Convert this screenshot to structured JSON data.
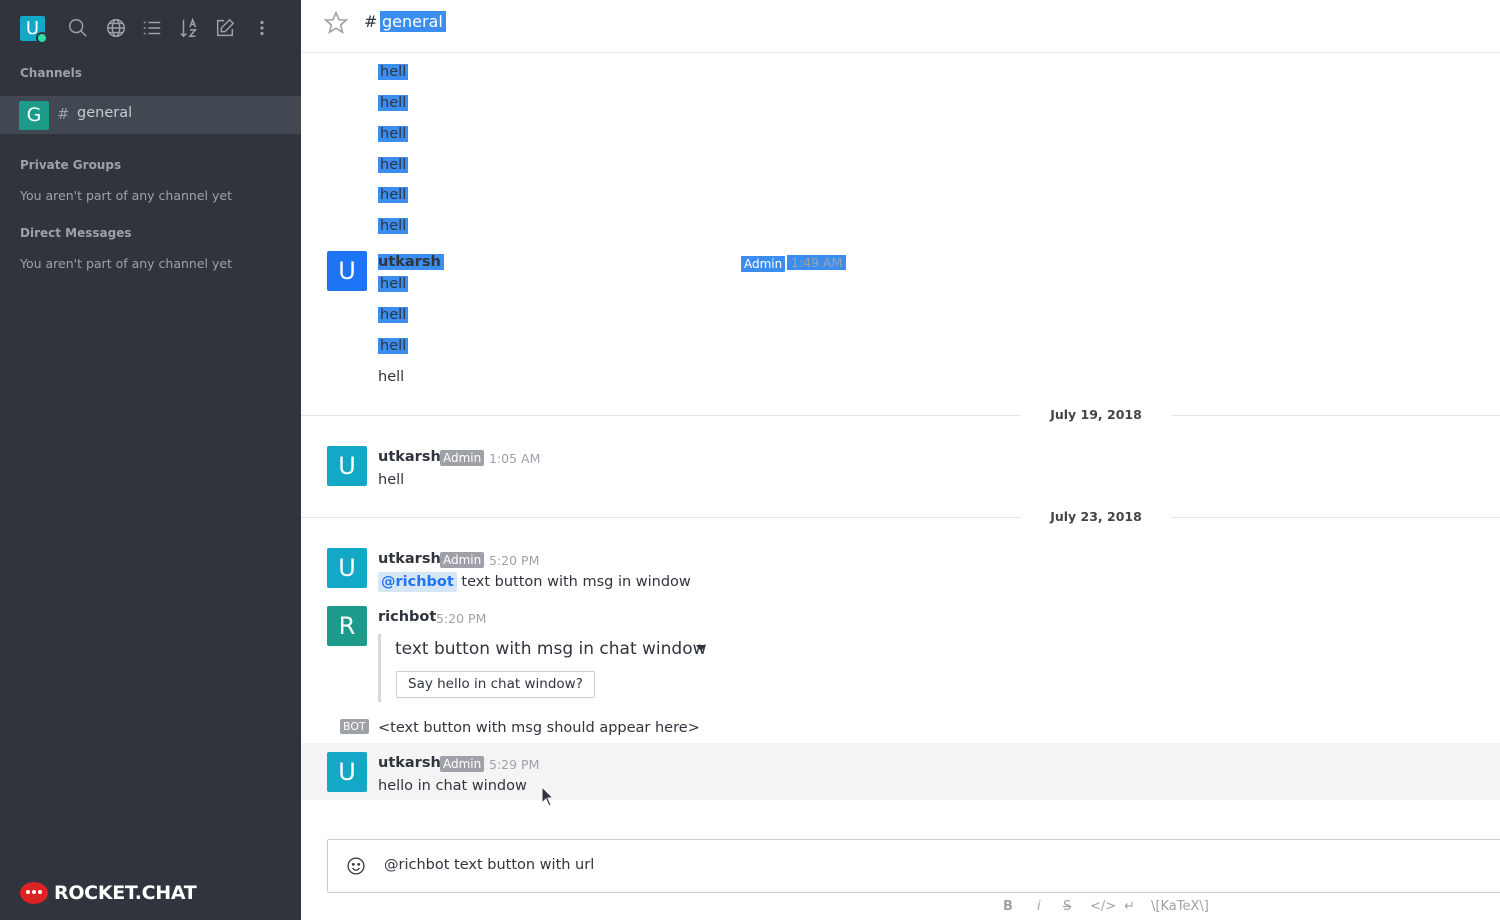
{
  "sidebar": {
    "user_initial": "U",
    "icons": [
      "search-icon",
      "globe-icon",
      "list-icon",
      "sort-icon",
      "edit-icon",
      "more-icon"
    ],
    "channels_title": "Channels",
    "channel": {
      "initial": "G",
      "hash": "#",
      "name": "general"
    },
    "private_groups_title": "Private Groups",
    "private_groups_empty": "You aren't part of any channel yet",
    "direct_messages_title": "Direct Messages",
    "direct_messages_empty": "You aren't part of any channel yet",
    "logo_text": "ROCKET.CHAT"
  },
  "header": {
    "hash": "#",
    "room": "general"
  },
  "messages": {
    "top_lines": [
      "hell",
      "hell",
      "hell",
      "hell",
      "hell",
      "hell"
    ],
    "m1": {
      "initial": "U",
      "user": "utkarsh",
      "role": "Admin",
      "time": "1:49 AM",
      "lines": [
        "hell",
        "hell",
        "hell",
        "hell"
      ]
    },
    "date1": "July 19, 2018",
    "m2": {
      "initial": "U",
      "user": "utkarsh",
      "role": "Admin",
      "time": "1:05 AM",
      "text": "hell"
    },
    "date2": "July 23, 2018",
    "m3": {
      "initial": "U",
      "user": "utkarsh",
      "role": "Admin",
      "time": "5:20 PM",
      "mention": "@richbot",
      "text": "text button with msg in window"
    },
    "m4": {
      "initial": "R",
      "user": "richbot",
      "time": "5:20 PM",
      "attachment_title": "text button with msg in chat window",
      "button": "Say hello in chat window?"
    },
    "bot": {
      "badge": "BOT",
      "text": "<text button with msg should appear here>"
    },
    "m5": {
      "initial": "U",
      "user": "utkarsh",
      "role": "Admin",
      "time": "5:29 PM",
      "text": "hello in chat window"
    }
  },
  "composer": {
    "value": "@richbot text button with url",
    "format": {
      "bold": "B",
      "italic": "i",
      "strike": "S",
      "code": "</>",
      "newline": "↵",
      "katex": "\\[KaTeX\\]"
    }
  },
  "colors": {
    "sidebar": "#2f343d",
    "selection": "#3b8ef0",
    "accent_teal": "#12a8c6",
    "logo_red": "#db2323"
  }
}
